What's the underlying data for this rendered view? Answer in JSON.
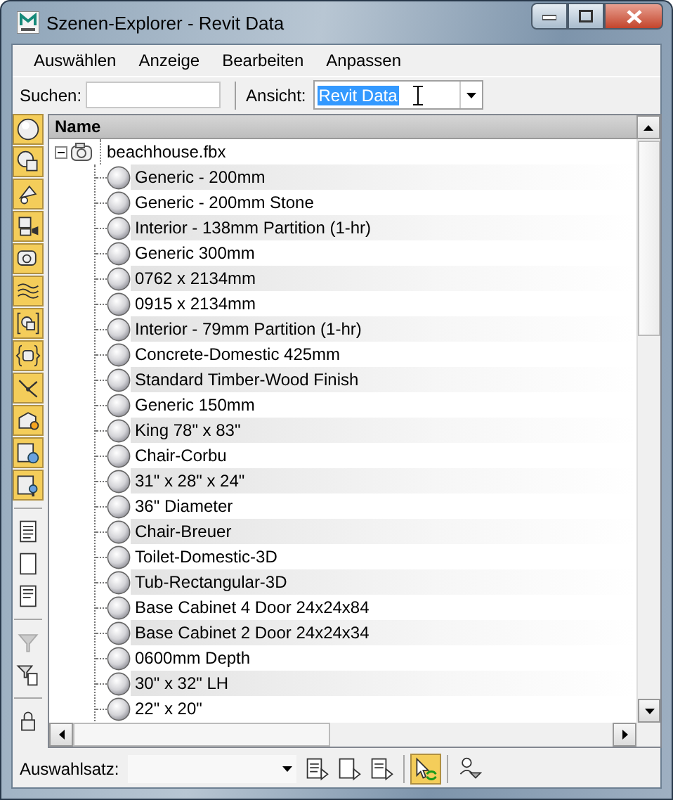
{
  "window": {
    "title": "Szenen-Explorer - Revit Data"
  },
  "menu": [
    "Auswählen",
    "Anzeige",
    "Bearbeiten",
    "Anpassen"
  ],
  "search": {
    "label": "Suchen:"
  },
  "view": {
    "label": "Ansicht:",
    "value": "Revit Data"
  },
  "side_toolbar": [
    {
      "kind": "toggle",
      "on": true
    },
    {
      "kind": "toggle",
      "on": true
    },
    {
      "kind": "toggle",
      "on": true
    },
    {
      "kind": "toggle",
      "on": true
    },
    {
      "kind": "toggle",
      "on": true
    },
    {
      "kind": "toggle",
      "on": true
    },
    {
      "kind": "toggle",
      "on": true
    },
    {
      "kind": "toggle",
      "on": true
    },
    {
      "kind": "toggle",
      "on": true
    },
    {
      "kind": "toggle",
      "on": true
    },
    {
      "kind": "toggle",
      "on": true
    },
    {
      "kind": "toggle",
      "on": true
    },
    {
      "kind": "separator"
    },
    {
      "kind": "button"
    },
    {
      "kind": "button"
    },
    {
      "kind": "button"
    },
    {
      "kind": "separator"
    },
    {
      "kind": "button"
    },
    {
      "kind": "button"
    },
    {
      "kind": "separator"
    },
    {
      "kind": "button"
    }
  ],
  "tree": {
    "column": "Name",
    "root": {
      "name": "beachhouse.fbx",
      "expanded": true,
      "children": [
        {
          "name": "Generic - 200mm"
        },
        {
          "name": "Generic - 200mm Stone"
        },
        {
          "name": "Interior - 138mm Partition (1-hr)"
        },
        {
          "name": "Generic 300mm"
        },
        {
          "name": "0762 x 2134mm"
        },
        {
          "name": "0915 x 2134mm"
        },
        {
          "name": "Interior - 79mm Partition (1-hr)"
        },
        {
          "name": "Concrete-Domestic 425mm"
        },
        {
          "name": "Standard Timber-Wood Finish"
        },
        {
          "name": "Generic 150mm"
        },
        {
          "name": "King 78\" x 83\""
        },
        {
          "name": "Chair-Corbu"
        },
        {
          "name": "31\" x 28\" x 24\""
        },
        {
          "name": "36\" Diameter"
        },
        {
          "name": "Chair-Breuer"
        },
        {
          "name": "Toilet-Domestic-3D"
        },
        {
          "name": "Tub-Rectangular-3D"
        },
        {
          "name": "Base Cabinet 4 Door 24x24x84"
        },
        {
          "name": "Base Cabinet 2 Door 24x24x34"
        },
        {
          "name": "0600mm Depth"
        },
        {
          "name": "30\" x 32\" LH"
        },
        {
          "name": "22\" x 20\""
        }
      ]
    }
  },
  "bottom": {
    "label": "Auswahlsatz:",
    "tools": [
      {
        "kind": "button"
      },
      {
        "kind": "button"
      },
      {
        "kind": "button"
      },
      {
        "kind": "separator"
      },
      {
        "kind": "toggle",
        "on": true
      },
      {
        "kind": "separator"
      },
      {
        "kind": "toggle",
        "on": false
      }
    ]
  }
}
